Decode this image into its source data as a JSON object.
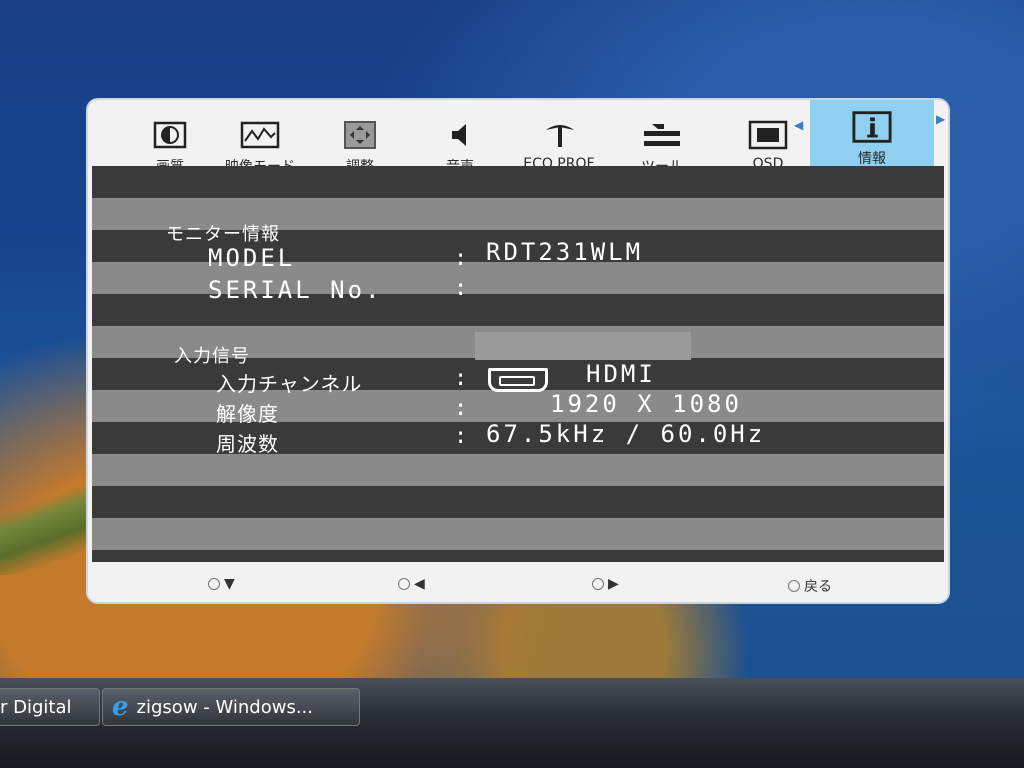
{
  "osd": {
    "tabs": [
      {
        "label": "画質",
        "icon": "contrast-icon"
      },
      {
        "label": "映像モード",
        "icon": "waveform-icon"
      },
      {
        "label": "調整",
        "icon": "adjust-icon"
      },
      {
        "label": "音声",
        "icon": "speaker-icon"
      },
      {
        "label": "ECO PROF.",
        "icon": "eco-icon"
      },
      {
        "label": "ツール",
        "icon": "tool-icon"
      },
      {
        "label": "OSD",
        "icon": "osd-icon"
      },
      {
        "label": "情報",
        "icon": "info-icon",
        "active": true
      }
    ],
    "monitor_info": {
      "title": "モニター情報",
      "model_label": "MODEL",
      "model_value": "RDT231WLM",
      "serial_label": "SERIAL No.",
      "serial_value": ""
    },
    "input_signal": {
      "title": "入力信号",
      "channel_label": "入力チャンネル",
      "channel_value": "HDMI",
      "resolution_label": "解像度",
      "resolution_value": "1920 X 1080",
      "frequency_label": "周波数",
      "frequency_value": "67.5kHz / 60.0Hz"
    },
    "colon": ":",
    "bottom_nav": {
      "back_label": "戻る"
    }
  },
  "taskbar": {
    "item1": "r Digital",
    "item2": "zigsow - Windows..."
  }
}
